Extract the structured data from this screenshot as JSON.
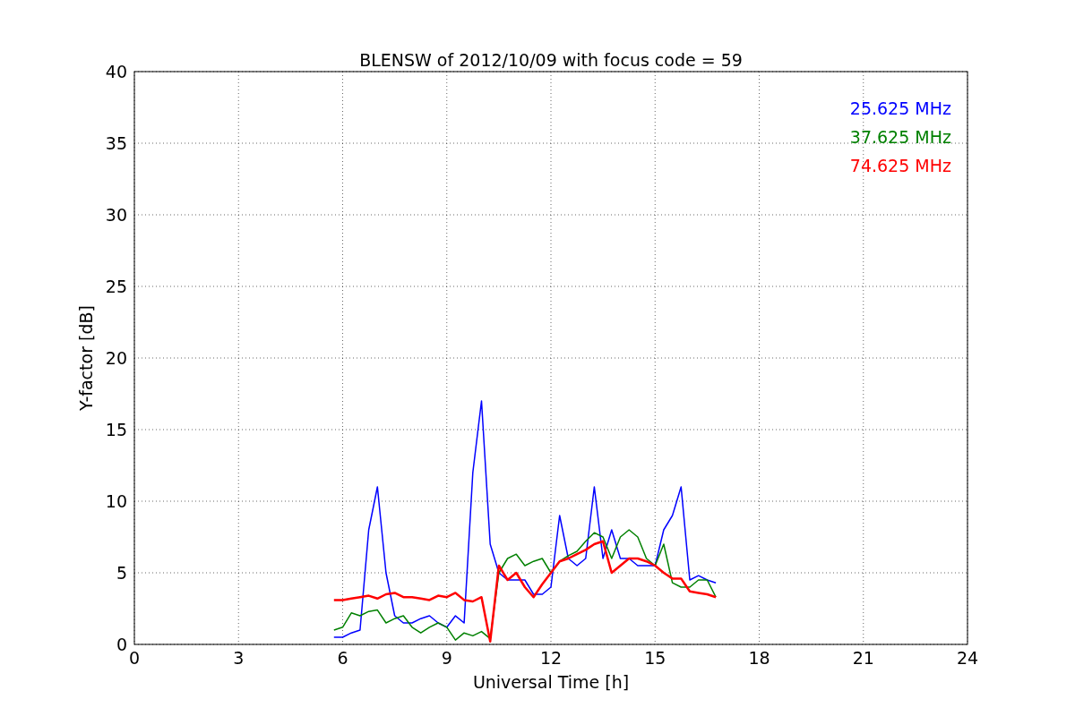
{
  "chart_data": {
    "type": "line",
    "title": "BLENSW of 2012/10/09 with focus code = 59",
    "xlabel": "Universal Time [h]",
    "ylabel": "Y-factor [dB]",
    "x": [
      5.75,
      6,
      6.25,
      6.5,
      6.75,
      7,
      7.25,
      7.5,
      7.75,
      8,
      8.25,
      8.5,
      8.75,
      9,
      9.25,
      9.5,
      9.75,
      10,
      10.25,
      10.5,
      10.75,
      11,
      11.25,
      11.5,
      11.75,
      12,
      12.25,
      12.5,
      12.75,
      13,
      13.25,
      13.5,
      13.75,
      14,
      14.25,
      14.5,
      14.75,
      15,
      15.25,
      15.5,
      15.75,
      16,
      16.25,
      16.5,
      16.75
    ],
    "series": [
      {
        "name": "25.625 MHz",
        "color": "#0000ff",
        "values": [
          0.5,
          0.5,
          0.8,
          1,
          8,
          11,
          5,
          2,
          1.5,
          1.5,
          1.8,
          2,
          1.5,
          1.2,
          2,
          1.5,
          12,
          17,
          7,
          5,
          4.5,
          4.5,
          4.5,
          3.5,
          3.5,
          4,
          9,
          6,
          5.5,
          6,
          11,
          6,
          8,
          6,
          6,
          5.5,
          5.5,
          5.5,
          8,
          9,
          11,
          4.5,
          4.8,
          4.5,
          4.3
        ]
      },
      {
        "name": "37.625 MHz",
        "color": "#008000",
        "values": [
          1,
          1.2,
          2.2,
          2,
          2.3,
          2.4,
          1.5,
          1.8,
          2,
          1.2,
          0.8,
          1.2,
          1.5,
          1.2,
          0.3,
          0.8,
          0.6,
          0.9,
          0.4,
          5,
          6,
          6.3,
          5.5,
          5.8,
          6,
          5,
          5.8,
          6.2,
          6.5,
          7.2,
          7.8,
          7.5,
          6,
          7.5,
          8,
          7.5,
          6,
          5.5,
          7,
          4.3,
          4,
          4,
          4.5,
          4.5,
          3.3
        ]
      },
      {
        "name": "74.625 MHz",
        "color": "#ff0000",
        "values": [
          3.1,
          3.1,
          3.2,
          3.3,
          3.4,
          3.2,
          3.5,
          3.6,
          3.3,
          3.3,
          3.2,
          3.1,
          3.4,
          3.3,
          3.6,
          3.1,
          3,
          3.3,
          0.2,
          5.5,
          4.5,
          5,
          4,
          3.3,
          4.2,
          5,
          5.8,
          6,
          6.3,
          6.6,
          7,
          7.2,
          5,
          5.5,
          6,
          6,
          5.8,
          5.5,
          5,
          4.6,
          4.6,
          3.7,
          3.6,
          3.5,
          3.3
        ]
      }
    ],
    "grid": true,
    "xlim": [
      0,
      24
    ],
    "ylim": [
      0,
      40
    ],
    "xticks": [
      0,
      3,
      6,
      9,
      12,
      15,
      18,
      21,
      24
    ],
    "yticks": [
      0,
      5,
      10,
      15,
      20,
      25,
      30,
      35,
      40
    ]
  }
}
